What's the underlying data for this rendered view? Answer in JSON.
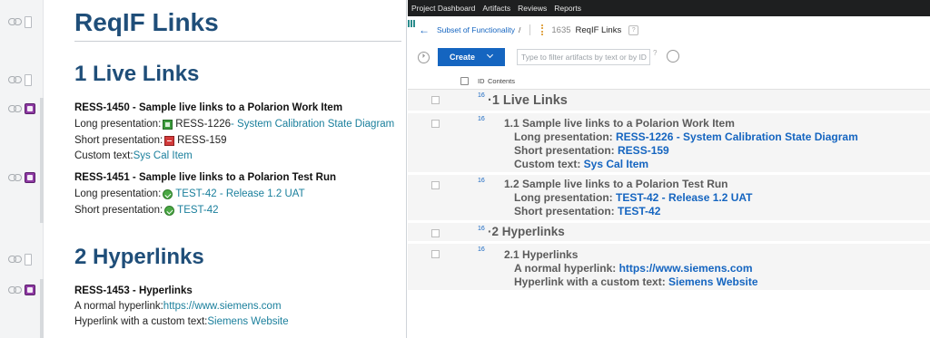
{
  "left_doc": {
    "title": "ReqIF Links",
    "sections": [
      {
        "heading": "1 Live Links",
        "items": [
          {
            "title": "RESS-1450 - Sample live links to a Polarion Work Item",
            "lines": [
              {
                "label": "Long presentation: ",
                "link_id": "RESS-1226",
                "link_text": " - System Calibration State Diagram"
              },
              {
                "label": "Short presentation: ",
                "link_id": "RESS-159"
              },
              {
                "label": "Custom text: ",
                "link_text": "Sys Cal Item"
              }
            ]
          },
          {
            "title": "RESS-1451 - Sample live links to a Polarion Test Run",
            "lines": [
              {
                "label": "Long presentation: ",
                "link_text": "TEST-42 - Release 1.2 UAT"
              },
              {
                "label": "Short presentation: ",
                "link_text": "TEST-42"
              }
            ]
          }
        ]
      },
      {
        "heading": "2 Hyperlinks",
        "items": [
          {
            "title": "RESS-1453 - Hyperlinks",
            "lines": [
              {
                "label": "A normal hyperlink: ",
                "link_text": "https://www.siemens.com"
              },
              {
                "label": "Hyperlink with a custom text: ",
                "link_text": "Siemens Website"
              }
            ]
          }
        ]
      }
    ]
  },
  "right_app": {
    "menu": [
      "Project Dashboard",
      "Artifacts",
      "Reviews",
      "Reports"
    ],
    "breadcrumb": {
      "back": "←",
      "parent": "Subset of Functionality",
      "sep": "/",
      "id": "1635",
      "title": "ReqIF Links",
      "help": "?"
    },
    "toolbar": {
      "create": "Create",
      "filter_placeholder": "Type to filter artifacts by text or by ID",
      "filter_help": "?"
    },
    "table": {
      "headers": [
        "ID",
        "Contents"
      ],
      "rows": [
        {
          "id": "16",
          "lines": [
            "·1  Live Links"
          ]
        },
        {
          "id": "16",
          "heading": "1.1  Sample live links to a Polarion Work Item",
          "lines": [
            {
              "label": "Long presentation: ",
              "link": "RESS-1226 - System Calibration State Diagram"
            },
            {
              "label": "Short presentation: ",
              "link": "RESS-159"
            },
            {
              "label": "Custom text: ",
              "link": "Sys Cal Item"
            }
          ]
        },
        {
          "id": "16",
          "heading": "1.2  Sample live links to a Polarion Test Run",
          "lines": [
            {
              "label": "Long presentation: ",
              "link": "TEST-42 - Release 1.2 UAT"
            },
            {
              "label": "Short presentation: ",
              "link": "TEST-42"
            }
          ]
        },
        {
          "id": "16",
          "lines": [
            "·2  Hyperlinks"
          ]
        },
        {
          "id": "16",
          "heading": "2.1  Hyperlinks",
          "lines": [
            {
              "label": "A normal hyperlink: ",
              "link": "https://www.siemens.com"
            },
            {
              "label": "Hyperlink with a custom text: ",
              "link": "Siemens Website"
            }
          ]
        }
      ]
    }
  }
}
